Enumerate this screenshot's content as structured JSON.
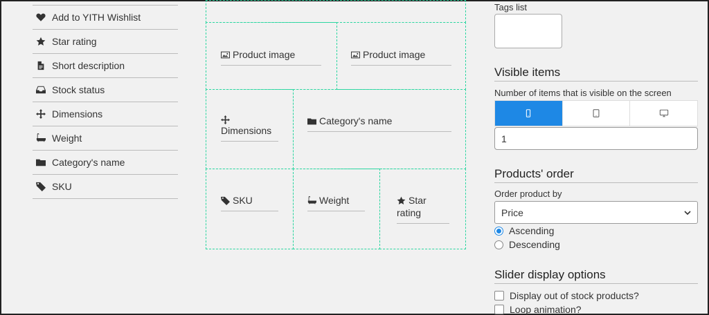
{
  "left_list": [
    {
      "label": "Add to YITH Wishlist",
      "icon": "heart-icon"
    },
    {
      "label": "Star rating",
      "icon": "star-icon"
    },
    {
      "label": "Short description",
      "icon": "document-icon"
    },
    {
      "label": "Stock status",
      "icon": "inbox-icon"
    },
    {
      "label": "Dimensions",
      "icon": "move-arrows-icon"
    },
    {
      "label": "Weight",
      "icon": "bathtub-icon"
    },
    {
      "label": "Category's name",
      "icon": "folder-icon"
    },
    {
      "label": "SKU",
      "icon": "tag-icon"
    }
  ],
  "builder": {
    "r1c1": "Product image",
    "r1c2": "Product image",
    "r2c1": "Dimensions",
    "r2c2": "Category's name",
    "r3c1": "SKU",
    "r3c2": "Weight",
    "r3c3_line1": "Star",
    "r3c3_line2": "rating"
  },
  "right": {
    "tags_label": "Tags list",
    "visible_title": "Visible items",
    "visible_desc": "Number of items that is visible on the screen",
    "device_tabs": [
      "mobile-icon",
      "tablet-icon",
      "desktop-icon"
    ],
    "visible_value": "1",
    "order_title": "Products' order",
    "order_label": "Order product by",
    "order_value": "Price",
    "ascending": "Ascending",
    "descending": "Descending",
    "slider_title": "Slider display options",
    "opt_out_of_stock": "Display out of stock products?",
    "opt_loop": "Loop animation?"
  },
  "colors": {
    "accent": "#1e88e5",
    "grid_border": "#2bd6a0"
  }
}
